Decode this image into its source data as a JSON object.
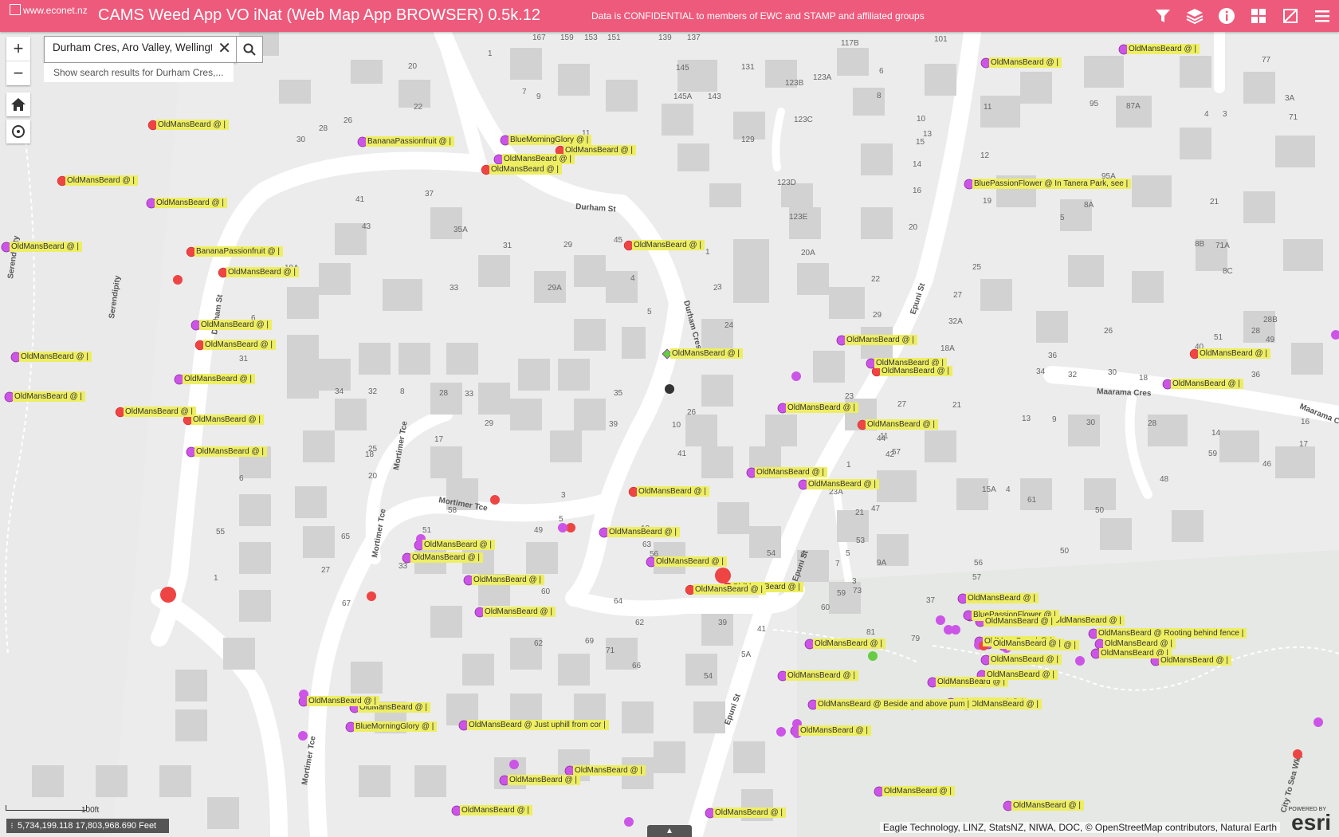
{
  "header": {
    "logo_alt": "www.econet.nz",
    "title": "CAMS Weed App VO iNat (Web Map App BROWSER) 0.5k.12",
    "confidentiality": "Data is CONFIDENTIAL to members of EWC and STAMP and affiliated groups",
    "icons": [
      "filter-icon",
      "layers-icon",
      "info-icon",
      "grid-icon",
      "collapse-icon",
      "menu-icon"
    ]
  },
  "search": {
    "value": "Durham Cres, Aro Valley, Wellington",
    "suggestion": "Show search results for Durham Cres,..."
  },
  "map_controls": {
    "zoom_in": "+",
    "zoom_out": "−"
  },
  "status": {
    "coordinates": "5,734,199.118 17,803,968.690 Feet",
    "scale": "100ft",
    "attribution": "Eagle Technology, LINZ, StatsNZ, NIWA, DOC, © OpenStreetMap contributors, Natural Earth",
    "esri_powered": "POWERED BY",
    "esri": "esri"
  },
  "colors": {
    "header": "#ee5a7c",
    "label_bg": "#eeee62",
    "point_red": "#ee4444",
    "point_purple": "#cc55e8",
    "point_green": "#66cc44"
  },
  "streets": [
    "Durham St",
    "Durham Cres",
    "Durham St",
    "Mortimer Tce",
    "Mortimer Tce",
    "Mortimer Tce",
    "Mortimer Tce",
    "Epuni St",
    "Epuni St",
    "Epuni St",
    "Maarama Cres",
    "Maarama Cres",
    "Serendipity",
    "Serendipity",
    "City To Sea Wky"
  ],
  "house_numbers": [
    "167",
    "159",
    "153",
    "151",
    "139",
    "137",
    "117B",
    "101",
    "1",
    "145",
    "131",
    "123B",
    "123A",
    "77",
    "20",
    "7",
    "9",
    "145A",
    "143",
    "129",
    "11",
    "6",
    "3A",
    "95",
    "87A",
    "4",
    "3",
    "71",
    "22",
    "30",
    "28",
    "26",
    "123C",
    "10",
    "13",
    "11",
    "8",
    "15",
    "12",
    "14",
    "123D",
    "16",
    "95A",
    "19",
    "21",
    "5",
    "8A",
    "41",
    "37",
    "35A",
    "123E",
    "20",
    "8B",
    "71A",
    "43",
    "31",
    "29",
    "1",
    "20A",
    "22",
    "25",
    "8C",
    "19A",
    "45",
    "2",
    "33",
    "29A",
    "4",
    "3",
    "27",
    "28B",
    "28",
    "49",
    "6",
    "5",
    "24",
    "29",
    "32A",
    "26",
    "51",
    "31",
    "18A",
    "36",
    "34",
    "32",
    "30",
    "18",
    "40",
    "38",
    "36",
    "34",
    "32",
    "8",
    "28",
    "33",
    "35",
    "29",
    "27",
    "21",
    "13",
    "9",
    "30",
    "28",
    "14",
    "16",
    "18",
    "11",
    "42",
    "26",
    "10",
    "39",
    "41",
    "25",
    "23",
    "17",
    "44",
    "57",
    "59",
    "46",
    "17",
    "20",
    "6",
    "1",
    "3",
    "5",
    "23A",
    "47",
    "15A",
    "4",
    "61",
    "48",
    "21",
    "50",
    "49",
    "51",
    "63",
    "50",
    "13",
    "2",
    "53",
    "55",
    "65",
    "27",
    "9A",
    "5",
    "7",
    "54",
    "3",
    "56",
    "57",
    "59",
    "1",
    "67",
    "33",
    "58",
    "60",
    "62",
    "56",
    "60",
    "64",
    "62",
    "81",
    "79",
    "77",
    "37",
    "66",
    "39",
    "41",
    "69",
    "71",
    "73",
    "75",
    "5A",
    "54"
  ],
  "observations": [
    {
      "label": "OldMansBeard @ |",
      "color": "red"
    },
    {
      "label": "BananaPassionfruit @ |",
      "color": "purple"
    },
    {
      "label": "BlueMorningGlory @ |",
      "color": "purple"
    },
    {
      "label": "OldMansBeard @ |",
      "color": "red"
    },
    {
      "label": "OldMansBeard @ |",
      "color": "purple"
    },
    {
      "label": "OldMansBeard @ |",
      "color": "red"
    },
    {
      "label": "OldMansBeard @ |",
      "color": "red"
    },
    {
      "label": "OldMansBeard @ |",
      "color": "purple"
    },
    {
      "label": "OldMansBeard @ |",
      "color": "purple"
    },
    {
      "label": "BananaPassionfruit @ |",
      "color": "red"
    },
    {
      "label": "OldMansBeard @ |",
      "color": "red"
    },
    {
      "label": "OldMansBeard @ |",
      "color": "purple"
    },
    {
      "label": "OldMansBeard @ |",
      "color": "red"
    },
    {
      "label": "OldMansBeard @ |",
      "color": "purple"
    },
    {
      "label": "OldMansBeard @ |",
      "color": "purple"
    },
    {
      "label": "OldMansBeard @ |",
      "color": "purple"
    },
    {
      "label": "OldMansBeard @ |",
      "color": "red"
    },
    {
      "label": "OldMansBeard @ |",
      "color": "red"
    },
    {
      "label": "OldMansBeard @ |",
      "color": "purple"
    },
    {
      "label": "OldMansBeard @ |",
      "color": "red"
    },
    {
      "label": "OldMansBeard @ |",
      "color": "red"
    },
    {
      "label": "OldMansBeard @ |",
      "color": "purple"
    },
    {
      "label": "OldMansBeard @ |",
      "color": "green"
    },
    {
      "label": "OldMansBeard @ |",
      "color": "purple"
    },
    {
      "label": "OldMansBeard @ |",
      "color": "purple"
    },
    {
      "label": "OldMansBeard @ |",
      "color": "purple"
    },
    {
      "label": "OldMansBeard @ |",
      "color": "purple"
    },
    {
      "label": "OldMansBeard @ |",
      "color": "purple"
    },
    {
      "label": "OldMansBeard @ |",
      "color": "purple"
    },
    {
      "label": "OldMansBeard @ |",
      "color": "purple"
    },
    {
      "label": "BluePassionFlower @ In Tanera Park, see |",
      "color": "purple"
    },
    {
      "label": "OldMansBeard @ |",
      "color": "purple"
    },
    {
      "label": "OldMansBeard @ |",
      "color": "red"
    },
    {
      "label": "OldMansBeard @ |",
      "color": "red"
    },
    {
      "label": "OldMansBeard @ |",
      "color": "purple"
    },
    {
      "label": "OldMansBeard @ |",
      "color": "purple"
    },
    {
      "label": "OldMansBeard @ |",
      "color": "purple"
    },
    {
      "label": "OldMansBeard @ |",
      "color": "purple"
    },
    {
      "label": "OldMansBeard @ |",
      "color": "red"
    },
    {
      "label": "OldMansBeard @ |",
      "color": "red"
    },
    {
      "label": "OldMansBeard @ |",
      "color": "red"
    },
    {
      "label": "OldMansBeard @ |",
      "color": "purple"
    },
    {
      "label": "OldMansBeard @ |",
      "color": "purple"
    },
    {
      "label": "OldMansBeard @ |",
      "color": "purple"
    },
    {
      "label": "OldMansBeard @ |",
      "color": "purple"
    },
    {
      "label": "OldMansBeard @ |",
      "color": "purple"
    },
    {
      "label": "OldMansBeard @ |",
      "color": "purple"
    },
    {
      "label": "OldMansBeard @ |",
      "color": "purple"
    },
    {
      "label": "OldMansBeard @ |",
      "color": "purple"
    },
    {
      "label": "OldMansBeard @ |",
      "color": "purple"
    },
    {
      "label": "OldMansBeard @ |",
      "color": "purple"
    },
    {
      "label": "OldMansBeard @ |",
      "color": "purple"
    },
    {
      "label": "OldMansBeard @ |",
      "color": "purple"
    },
    {
      "label": "OldMansBeard @ |",
      "color": "purple"
    },
    {
      "label": "BluePassionFlower @ |",
      "color": "purple"
    },
    {
      "label": "OldMansBeard @ |",
      "color": "purple"
    },
    {
      "label": "OldMansBeard @ |",
      "color": "purple"
    },
    {
      "label": "OldMansBeard @ Rooting behind fence |",
      "color": "purple"
    },
    {
      "label": "OldMansBeard @ |",
      "color": "purple"
    },
    {
      "label": "OldMansBeard @ |",
      "color": "purple"
    },
    {
      "label": "OldMansBeard @ |",
      "color": "purple"
    },
    {
      "label": "OldMansBeard @ |",
      "color": "purple"
    },
    {
      "label": "OldMansBeard @ |",
      "color": "purple"
    },
    {
      "label": "OldMansBeard @ Beside and above pum |",
      "color": "purple"
    },
    {
      "label": "OldMansBeard @ |",
      "color": "purple"
    },
    {
      "label": "OldMansBeard @ |",
      "color": "purple"
    },
    {
      "label": "OldMansBeard @ Just uphill from cor |",
      "color": "purple"
    },
    {
      "label": "OldMansBeard @ |",
      "color": "purple"
    },
    {
      "label": "OldMansBeard @ |",
      "color": "purple"
    },
    {
      "label": "OldMansBeard @ |",
      "color": "purple"
    },
    {
      "label": "OldMansBeard @ |",
      "color": "purple"
    },
    {
      "label": "OldMansBeard @ |",
      "color": "purple"
    },
    {
      "label": "BlueMorningGlory @ |",
      "color": "purple"
    },
    {
      "label": "OldMansBeard @ |",
      "color": "purple"
    }
  ]
}
